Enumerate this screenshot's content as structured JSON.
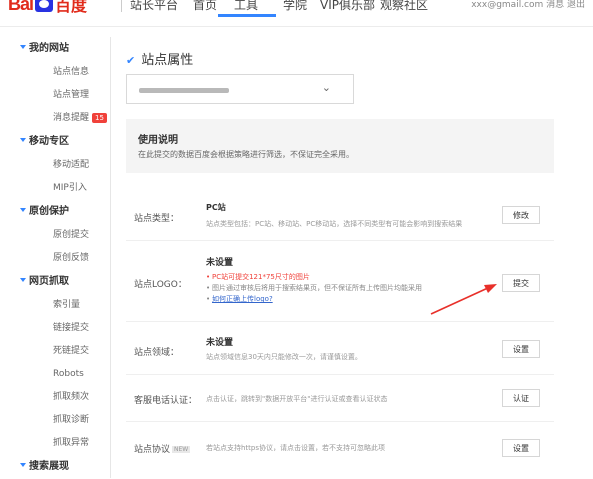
{
  "topbar": {
    "logo_left": "Bai",
    "logo_right": "百度",
    "nav": [
      {
        "label": "站长平台"
      },
      {
        "label": "首页"
      },
      {
        "label": "工具"
      },
      {
        "label": "学院"
      },
      {
        "label": "VIP俱乐部"
      },
      {
        "label": "观察社区"
      }
    ],
    "user": "xxx@gmail.com   消息   退出"
  },
  "sidebar": {
    "groups": [
      {
        "label": "我的网站",
        "items": [
          {
            "label": "站点信息"
          },
          {
            "label": "站点管理"
          },
          {
            "label": "消息提醒",
            "badge": "15"
          }
        ]
      },
      {
        "label": "移动专区",
        "items": [
          {
            "label": "移动适配"
          },
          {
            "label": "MIP引入"
          }
        ]
      },
      {
        "label": "原创保护",
        "items": [
          {
            "label": "原创提交"
          },
          {
            "label": "原创反馈"
          }
        ]
      },
      {
        "label": "网页抓取",
        "items": [
          {
            "label": "索引量"
          },
          {
            "label": "链接提交"
          },
          {
            "label": "死链提交"
          },
          {
            "label": "Robots"
          },
          {
            "label": "抓取频次"
          },
          {
            "label": "抓取诊断"
          },
          {
            "label": "抓取异常"
          }
        ]
      },
      {
        "label": "搜索展现",
        "items": []
      }
    ]
  },
  "main": {
    "title": "站点属性",
    "usage_title": "使用说明",
    "usage_desc": "在此提交的数据百度会根据策略进行筛选，不保证完全采用。",
    "rows": [
      {
        "label": "站点类型：",
        "value": "PC站",
        "desc": "站点类型包括：PC站、移动站、PC移动站，选择不同类型有可能会影响到搜索结果",
        "button": "修改"
      },
      {
        "label": "站点LOGO：",
        "value": "未设置",
        "bullets": [
          "PC站可提交121*75尺寸的图片",
          "图片通过审核后将用于搜索结果页，但不保证所有上传图片均能采用",
          "如何正确上传logo?"
        ],
        "button": "提交"
      },
      {
        "label": "站点领域：",
        "value": "未设置",
        "desc": "站点领域信息30天内只能修改一次，请谨慎设置。",
        "button": "设置"
      },
      {
        "label": "客服电话认证：",
        "desc": "点击认证，跳转到\"数据开放平台\"进行认证或查看认证状态",
        "button": "认证"
      },
      {
        "label": "站点协议",
        "tag": "NEW",
        "desc": "若站点支持https协议，请点击设置，若不支持可忽略此项",
        "button": "设置"
      }
    ]
  }
}
